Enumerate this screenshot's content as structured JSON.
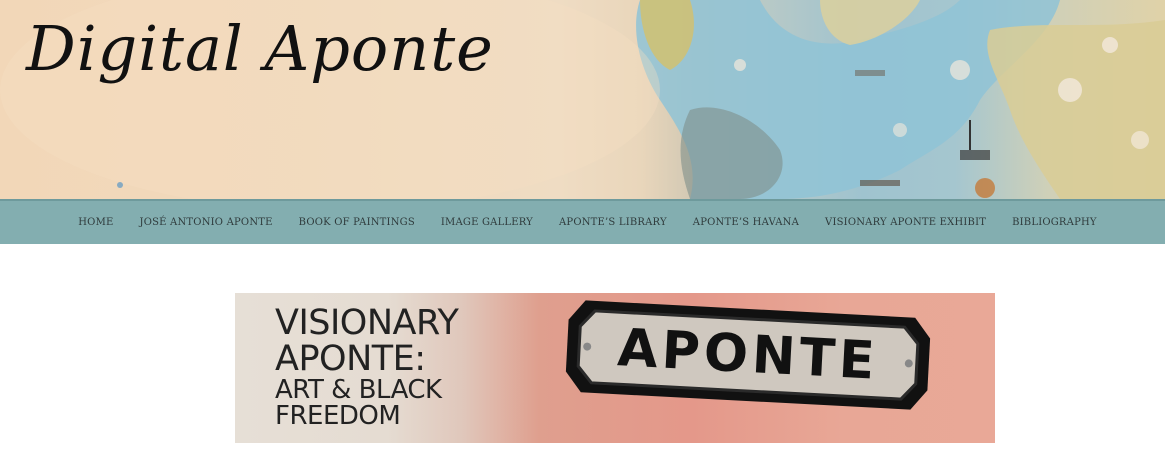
{
  "header": {
    "site_title": "Digital Aponte"
  },
  "nav": {
    "items": [
      {
        "label": "HOME"
      },
      {
        "label": "JOSÉ ANTONIO APONTE"
      },
      {
        "label": "BOOK OF PAINTINGS"
      },
      {
        "label": "IMAGE GALLERY"
      },
      {
        "label": "APONTE’S LIBRARY"
      },
      {
        "label": "APONTE’S HAVANA"
      },
      {
        "label": "VISIONARY APONTE EXHIBIT"
      },
      {
        "label": "BIBLIOGRAPHY"
      }
    ]
  },
  "exhibit_banner": {
    "title_line_1": "VISIONARY",
    "title_line_2": "APONTE:",
    "subtitle_line_1": "ART & BLACK",
    "subtitle_line_2": "FREEDOM",
    "sign_text": "APONTE"
  },
  "colors": {
    "nav_background": "#83aeb0",
    "nav_text": "#2f3b3c",
    "banner_text": "#222222"
  }
}
